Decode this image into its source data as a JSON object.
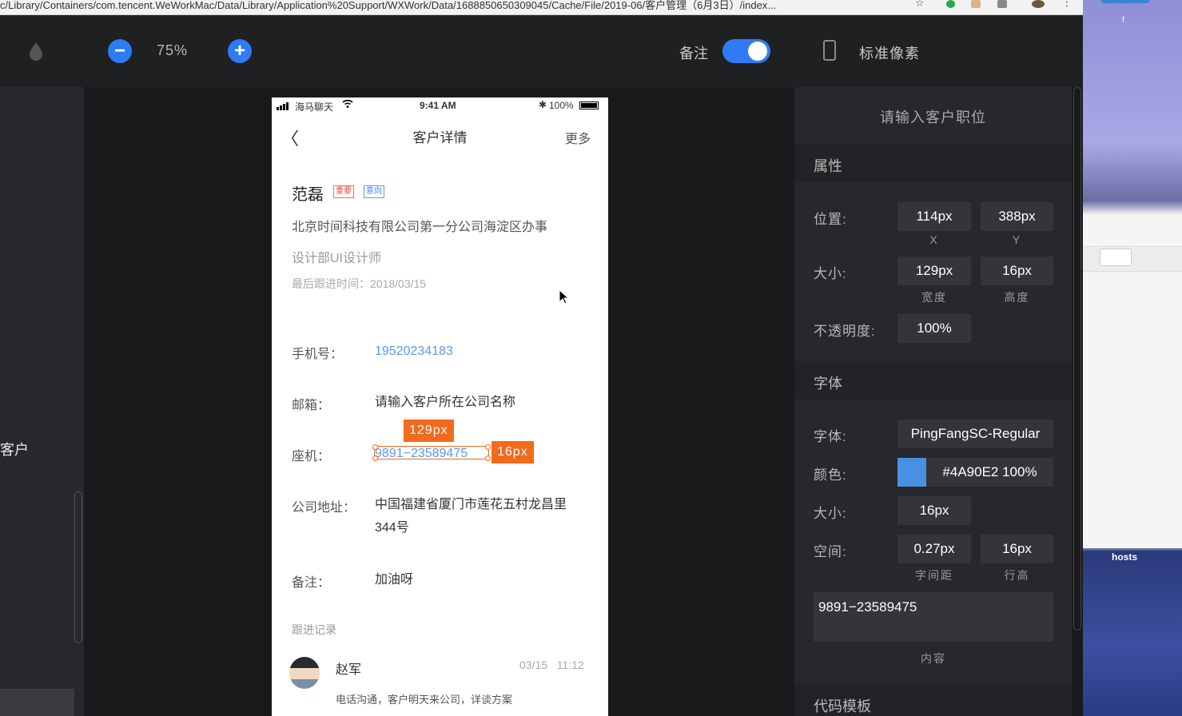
{
  "browser": {
    "url": "c/Library/Containers/com.tencent.WeWorkMac/Data/Library/Application%20Support/WXWork/Data/1688850650309045/Cache/File/2019-06/客户管理（6月3日）/index..."
  },
  "toolbar": {
    "zoom_value": "75%",
    "zoom_out_icon": "−",
    "zoom_in_icon": "+",
    "notes_label": "备注",
    "notes_toggle_on": true,
    "std_pixel_label": "标准像素",
    "drop_icon": "drop-icon"
  },
  "left_panel": {
    "label": "客户"
  },
  "phone": {
    "status": {
      "carrier": "海马聊天",
      "time": "9:41 AM",
      "battery": "100%"
    },
    "nav": {
      "back": "〈",
      "title": "客户详情",
      "more": "更多"
    },
    "customer": {
      "name": "范磊",
      "tag_important": "重要",
      "tag_intent": "意向",
      "company": "北京时间科技有限公司第一分公司海淀区办事",
      "dept": "设计部UI设计师",
      "last_follow": "最后跟进时间：2018/03/15"
    },
    "fields": {
      "phone_label": "手机号：",
      "phone_value": "19520234183",
      "email_label": "邮箱：",
      "email_value": "请输入客户所在公司名称",
      "landline_label": "座机：",
      "landline_value": "9891−23589475",
      "address_label": "公司地址：",
      "address_line1": "中国福建省厦门市莲花五村龙昌里",
      "address_line2": "344号",
      "note_label": "备注：",
      "note_value": "加油呀"
    },
    "follow": {
      "title": "跟进记录",
      "name": "赵军",
      "time": "03/15   11:12",
      "desc": "电话沟通，客户明天来公司，详谈方案"
    }
  },
  "measure": {
    "width_badge": "129px",
    "height_badge": "16px"
  },
  "inspector": {
    "title": "请输入客户职位",
    "attributes_header": "属性",
    "position_label": "位置:",
    "pos_x": "114px",
    "pos_y": "388px",
    "x_label": "X",
    "y_label": "Y",
    "size_label": "大小:",
    "width": "129px",
    "height": "16px",
    "width_label": "宽度",
    "height_label": "高度",
    "opacity_label": "不透明度:",
    "opacity": "100%",
    "font_header": "字体",
    "font_label": "字体:",
    "font_value": "PingFangSC-Regular",
    "color_label": "颜色:",
    "color_value": "#4A90E2 100%",
    "color_swatch": "#4A90E2",
    "fontsize_label": "大小:",
    "fontsize": "16px",
    "spacing_label": "空间:",
    "letter_spacing": "0.27px",
    "line_height": "16px",
    "letter_spacing_label": "字间距",
    "line_height_label": "行高",
    "content_value": "9891−23589475",
    "content_label": "内容",
    "code_header": "代码模板"
  },
  "desktop": {
    "hosts": "hosts",
    "f": "f"
  }
}
